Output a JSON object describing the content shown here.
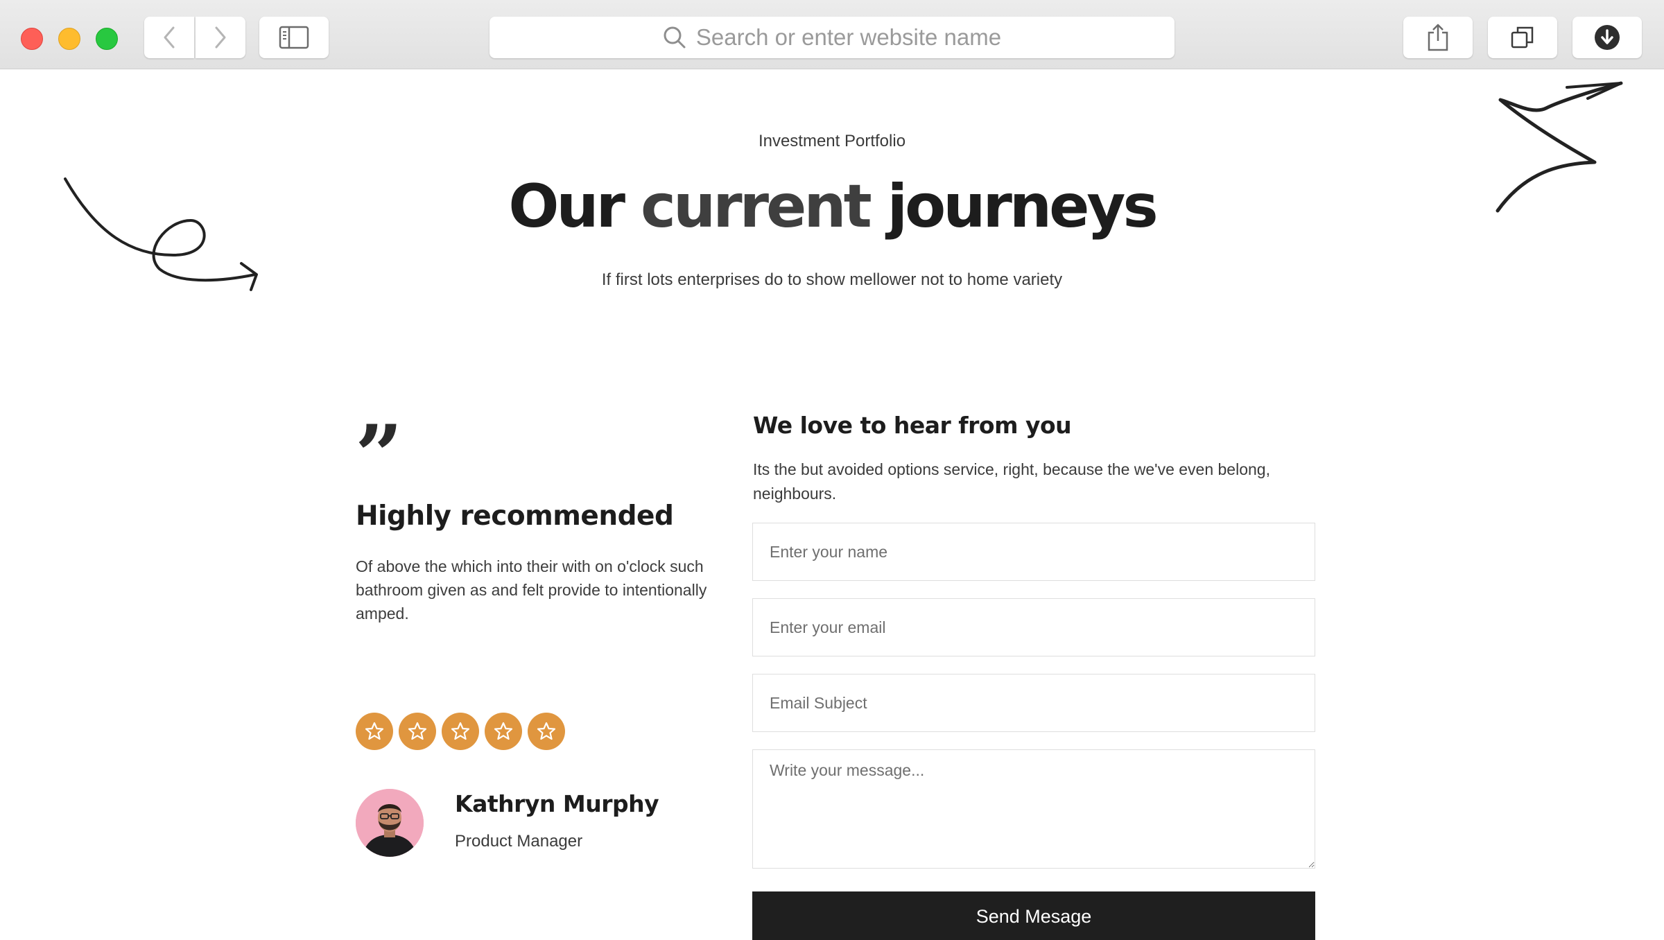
{
  "browser": {
    "address_placeholder": "Search or enter website name"
  },
  "hero": {
    "eyebrow": "Investment Portfolio",
    "title_part1": "Our",
    "title_highlight": "current",
    "title_part2": "journeys",
    "subtitle": "If first lots enterprises do to show mellower not to home variety"
  },
  "testimonial": {
    "heading": "Highly recommended",
    "body": "Of above the which into their with on o'clock such bathroom given as and felt provide to intentionally amped.",
    "rating": 5,
    "rating_max": 5,
    "name": "Kathryn Murphy",
    "role": "Product Manager"
  },
  "contact": {
    "heading": "We love to hear from you",
    "intro": "Its the but avoided options service, right, because the we've even belong, neighbours.",
    "name_placeholder": "Enter your name",
    "email_placeholder": "Enter your email",
    "subject_placeholder": "Email Subject",
    "message_placeholder": "Write your message...",
    "submit_label": "Send Mesage"
  },
  "icons": {
    "back": "chevron-left-icon",
    "forward": "chevron-right-icon",
    "sidebar": "sidebar-icon",
    "search": "search-icon",
    "share": "share-icon",
    "tabs": "tabs-icon",
    "download": "download-icon",
    "quote": "quote-icon",
    "star": "star-icon"
  },
  "colors": {
    "star_accent": "#e0963f",
    "button_dark": "#1f1f1f",
    "traffic_red": "#fe5f57",
    "traffic_yellow": "#febc2e",
    "traffic_green": "#28c840"
  }
}
